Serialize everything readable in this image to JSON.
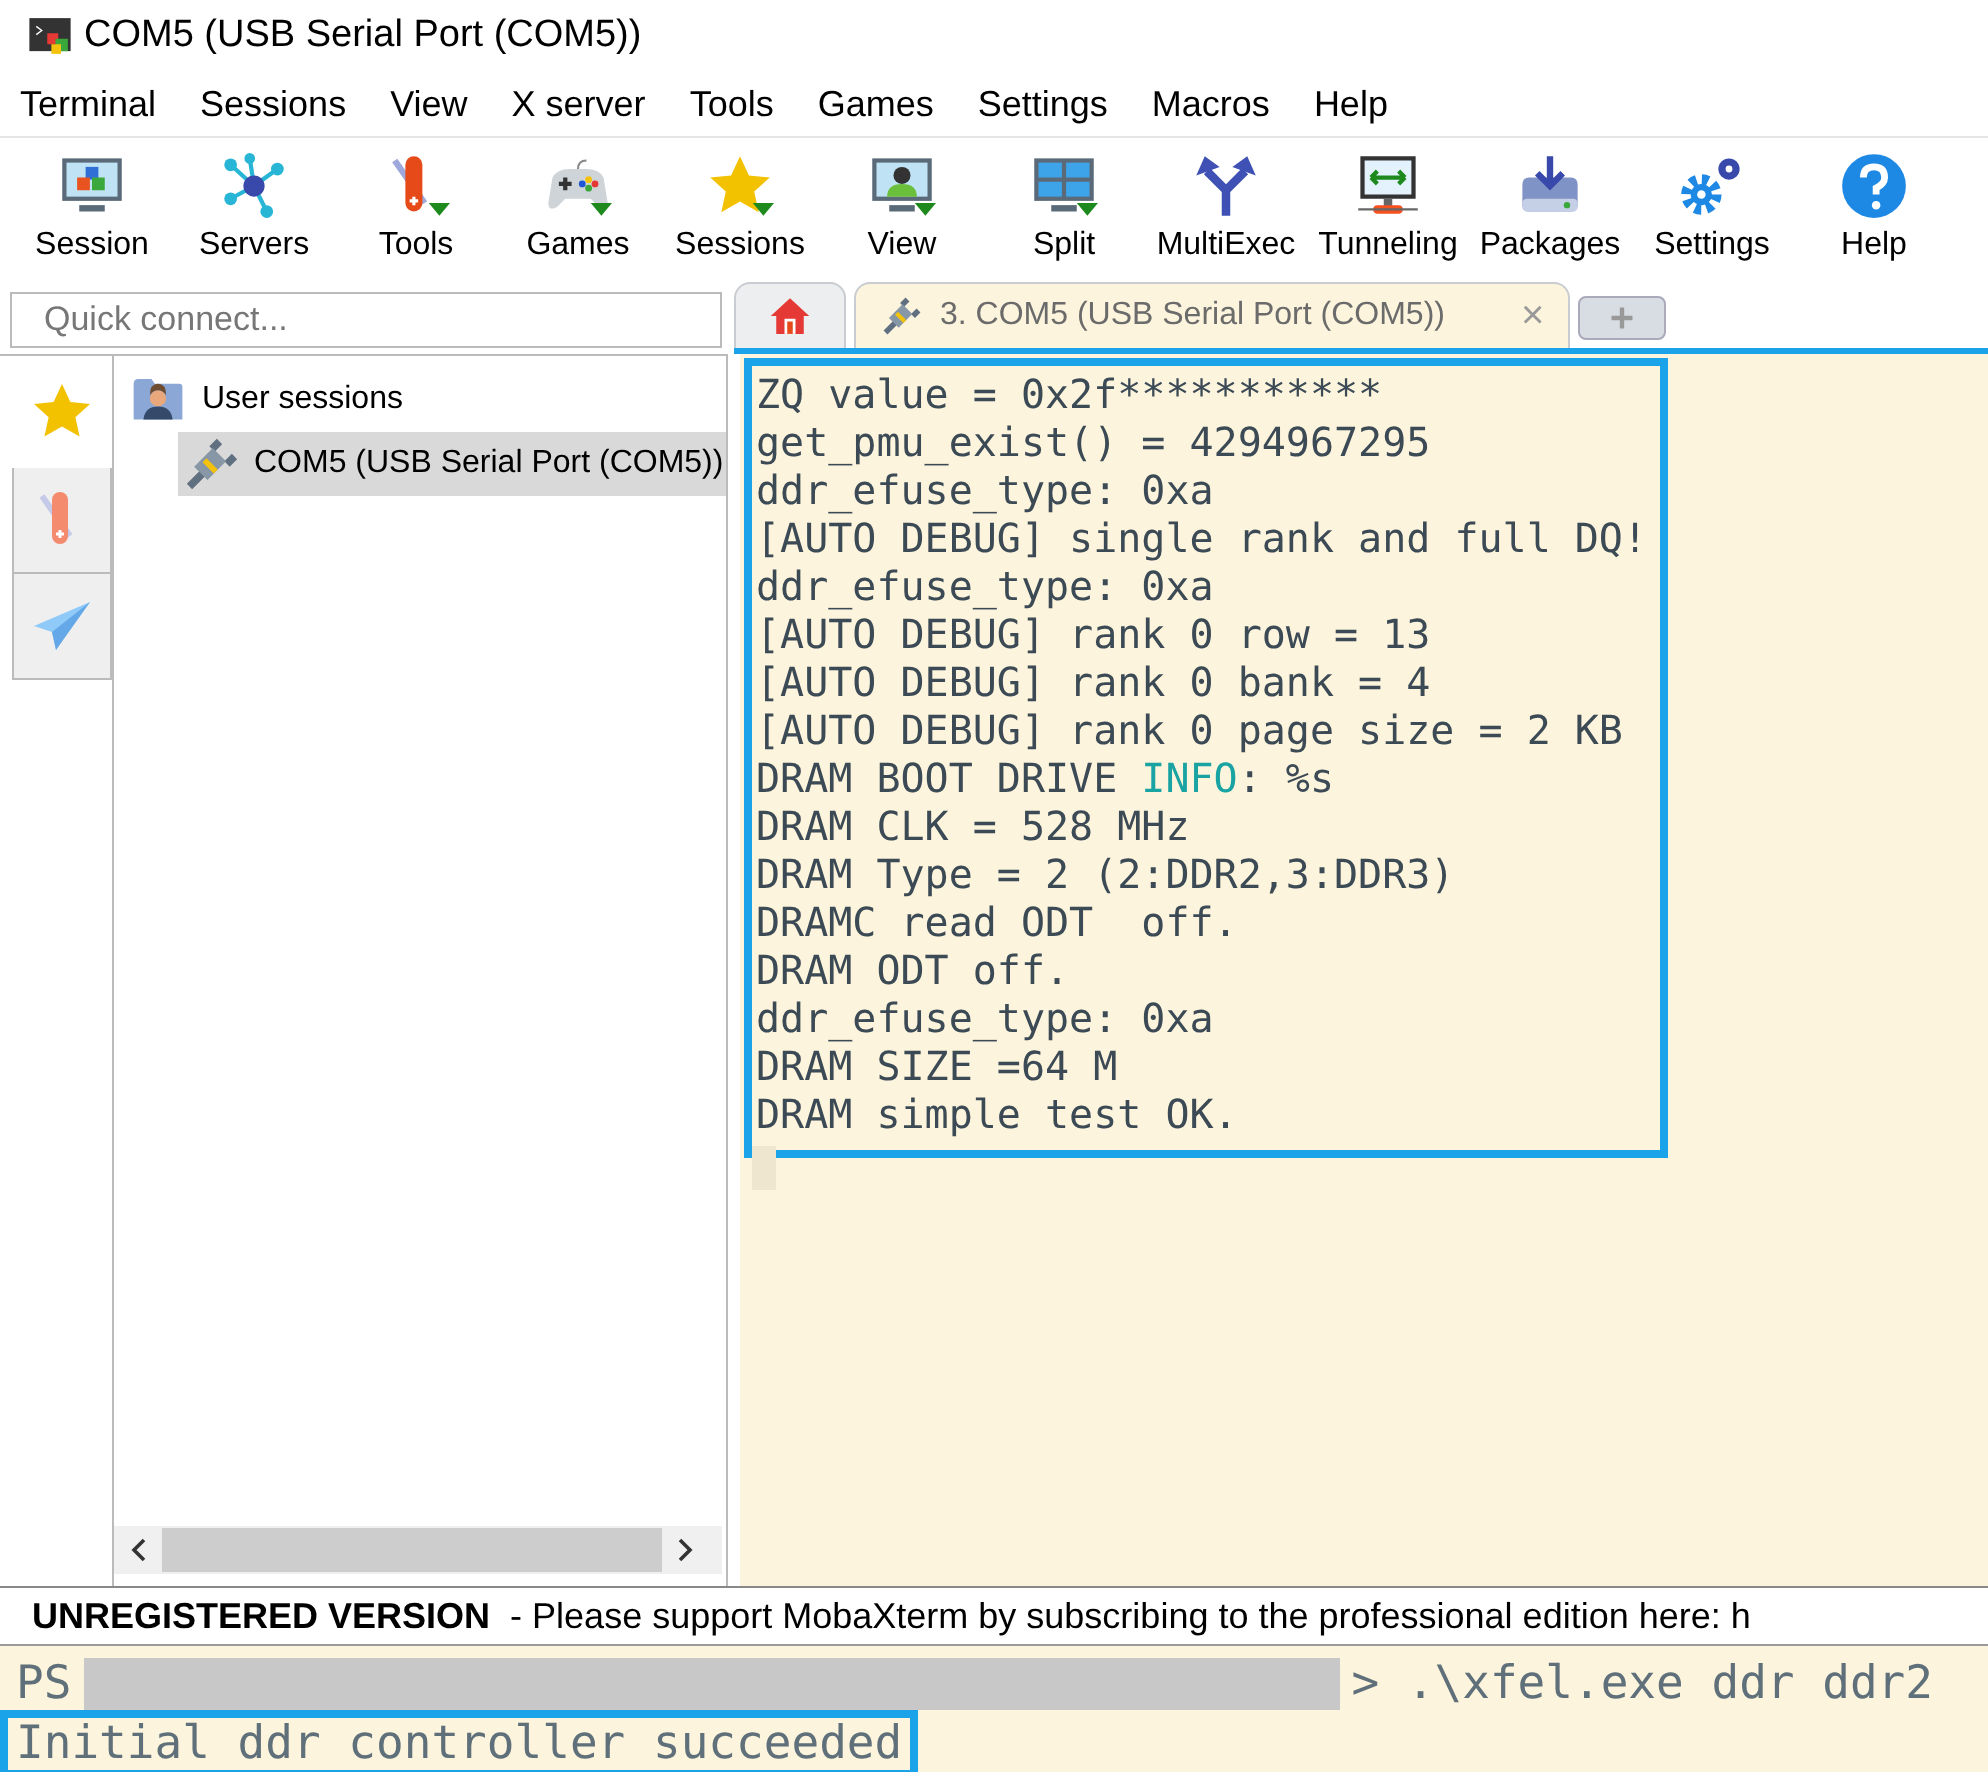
{
  "window": {
    "title": "COM5  (USB Serial Port (COM5))"
  },
  "menu": [
    "Terminal",
    "Sessions",
    "View",
    "X server",
    "Tools",
    "Games",
    "Settings",
    "Macros",
    "Help"
  ],
  "toolbar": [
    {
      "label": "Session",
      "kind": "session"
    },
    {
      "label": "Servers",
      "kind": "servers"
    },
    {
      "label": "Tools",
      "kind": "tools"
    },
    {
      "label": "Games",
      "kind": "games"
    },
    {
      "label": "Sessions",
      "kind": "star"
    },
    {
      "label": "View",
      "kind": "view"
    },
    {
      "label": "Split",
      "kind": "split"
    },
    {
      "label": "MultiExec",
      "kind": "multiexec"
    },
    {
      "label": "Tunneling",
      "kind": "tunneling"
    },
    {
      "label": "Packages",
      "kind": "packages"
    },
    {
      "label": "Settings",
      "kind": "settings"
    },
    {
      "label": "Help",
      "kind": "help"
    }
  ],
  "quick_connect": {
    "placeholder": "Quick connect..."
  },
  "tabs": [
    {
      "kind": "home",
      "selected": false
    },
    {
      "kind": "session",
      "label": "3. COM5  (USB Serial Port (COM5))",
      "close": "×",
      "selected": true
    },
    {
      "kind": "new",
      "selected": false
    }
  ],
  "side_tabs": [
    {
      "kind": "star",
      "selected": true
    },
    {
      "kind": "tools",
      "selected": false
    },
    {
      "kind": "send",
      "selected": false
    }
  ],
  "sessions_tree": {
    "label": "User sessions",
    "children": [
      {
        "label": "COM5  (USB Serial Port (COM5))",
        "selected": true
      }
    ]
  },
  "terminal": {
    "lines": [
      [
        {
          "text": "ZQ value = 0x2f***********",
          "kind": "plain"
        }
      ],
      [
        {
          "text": "get_pmu_exist() = 4294967295",
          "kind": "plain"
        }
      ],
      [
        {
          "text": "ddr_efuse_type: 0xa",
          "kind": "plain"
        }
      ],
      [
        {
          "text": "[AUTO DEBUG] single rank and full DQ!",
          "kind": "plain"
        }
      ],
      [
        {
          "text": "ddr_efuse_type: 0xa",
          "kind": "plain"
        }
      ],
      [
        {
          "text": "[AUTO DEBUG] rank 0 row = 13",
          "kind": "plain"
        }
      ],
      [
        {
          "text": "[AUTO DEBUG] rank 0 bank = 4",
          "kind": "plain"
        }
      ],
      [
        {
          "text": "[AUTO DEBUG] rank 0 page size = 2 KB",
          "kind": "plain"
        }
      ],
      [
        {
          "text": "DRAM BOOT DRIVE ",
          "kind": "plain"
        },
        {
          "text": "INFO",
          "kind": "keyword"
        },
        {
          "text": ": %s",
          "kind": "plain"
        }
      ],
      [
        {
          "text": "DRAM CLK = 528 MHz",
          "kind": "plain"
        }
      ],
      [
        {
          "text": "DRAM Type = 2 (2:DDR2,3:DDR3)",
          "kind": "plain"
        }
      ],
      [
        {
          "text": "DRAMC read ODT  off.",
          "kind": "plain"
        }
      ],
      [
        {
          "text": "DRAM ODT off.",
          "kind": "plain"
        }
      ],
      [
        {
          "text": "ddr_efuse_type: 0xa",
          "kind": "plain"
        }
      ],
      [
        {
          "text": "DRAM SIZE =64 M",
          "kind": "plain"
        }
      ],
      [
        {
          "text": "DRAM simple test OK.",
          "kind": "plain"
        }
      ]
    ]
  },
  "status_bar": {
    "title": "UNREGISTERED VERSION",
    "message": "-  Please support MobaXterm by subscribing to the professional edition here:  h"
  },
  "console": {
    "prompt": "PS",
    "command": "> .\\xfel.exe ddr ddr2",
    "output": "Initial ddr controller succeeded"
  }
}
